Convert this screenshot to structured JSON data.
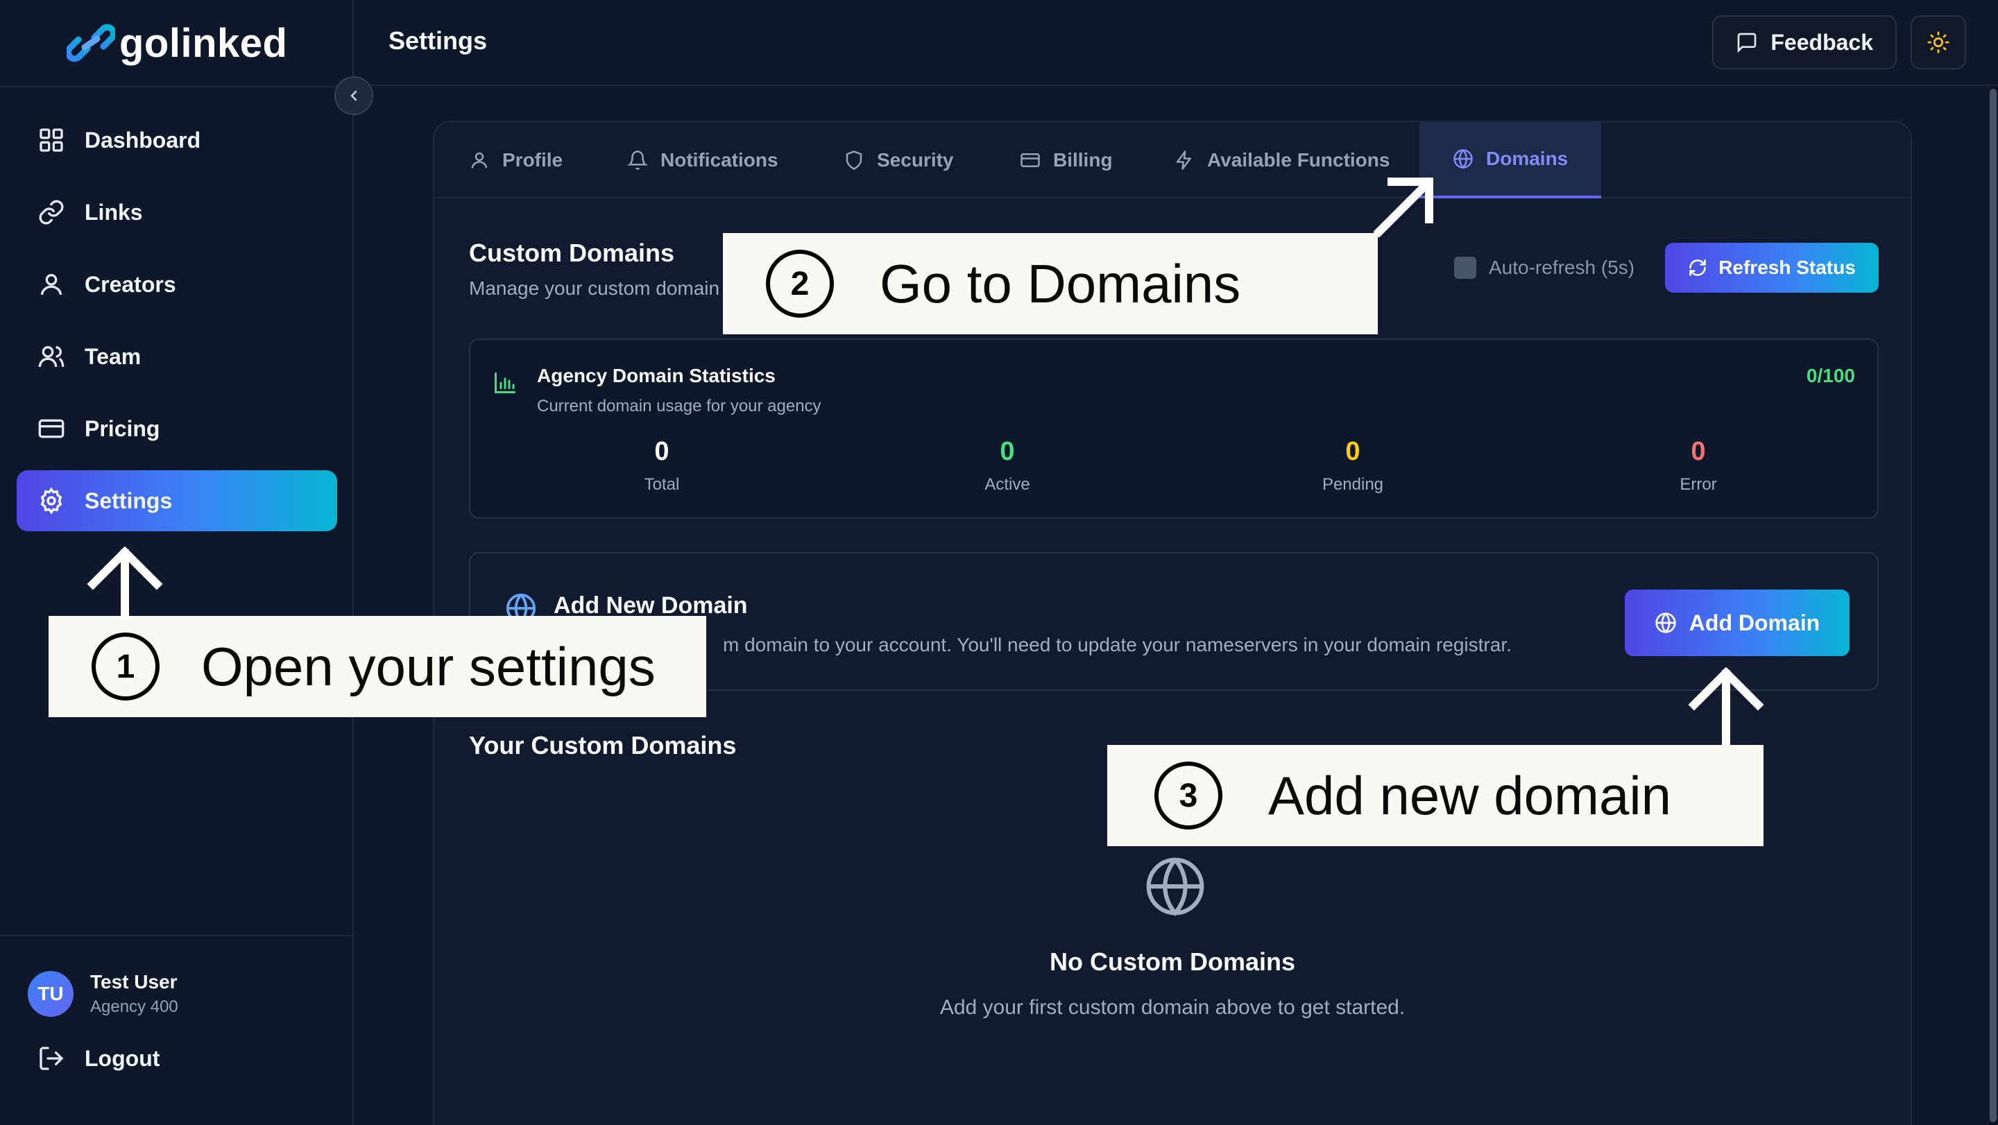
{
  "brand": {
    "name": "golinked"
  },
  "sidebar": {
    "items": [
      {
        "label": "Dashboard",
        "icon": "grid-icon"
      },
      {
        "label": "Links",
        "icon": "link-icon"
      },
      {
        "label": "Creators",
        "icon": "user-icon"
      },
      {
        "label": "Team",
        "icon": "users-icon"
      },
      {
        "label": "Pricing",
        "icon": "credit-card-icon"
      },
      {
        "label": "Settings",
        "icon": "gear-icon",
        "active": true
      }
    ],
    "user": {
      "initials": "TU",
      "name": "Test User",
      "subtitle": "Agency 400"
    },
    "logout_label": "Logout"
  },
  "header": {
    "title": "Settings",
    "feedback_label": "Feedback"
  },
  "tabs": [
    {
      "label": "Profile",
      "icon": "user-icon"
    },
    {
      "label": "Notifications",
      "icon": "bell-icon"
    },
    {
      "label": "Security",
      "icon": "shield-icon"
    },
    {
      "label": "Billing",
      "icon": "credit-card-icon"
    },
    {
      "label": "Available Functions",
      "icon": "bolt-icon"
    },
    {
      "label": "Domains",
      "icon": "globe-icon",
      "active": true
    }
  ],
  "domains": {
    "title": "Custom Domains",
    "subtitle": "Manage your custom domain",
    "auto_refresh_label": "Auto-refresh (5s)",
    "refresh_label": "Refresh Status",
    "stats": {
      "title": "Agency Domain Statistics",
      "subtitle": "Current domain usage for your agency",
      "usage": "0/100",
      "items": [
        {
          "value": "0",
          "label": "Total",
          "color": "#ffffff"
        },
        {
          "value": "0",
          "label": "Active",
          "color": "#4ade80"
        },
        {
          "value": "0",
          "label": "Pending",
          "color": "#facc15"
        },
        {
          "value": "0",
          "label": "Error",
          "color": "#f87171"
        }
      ]
    },
    "add": {
      "title": "Add New Domain",
      "description": "m domain to your account. You'll need to update your nameservers in your domain registrar.",
      "button_label": "Add Domain"
    },
    "list_title": "Your Custom Domains",
    "empty_title": "No Custom Domains",
    "empty_subtitle": "Add your first custom domain above to get started."
  },
  "annotations": [
    {
      "number": "1",
      "text": "Open your settings"
    },
    {
      "number": "2",
      "text": "Go to Domains"
    },
    {
      "number": "3",
      "text": "Add new domain"
    }
  ],
  "colors": {
    "accent": "#6366f1",
    "gradient_end": "#06b6d4",
    "background": "#0f172a"
  }
}
